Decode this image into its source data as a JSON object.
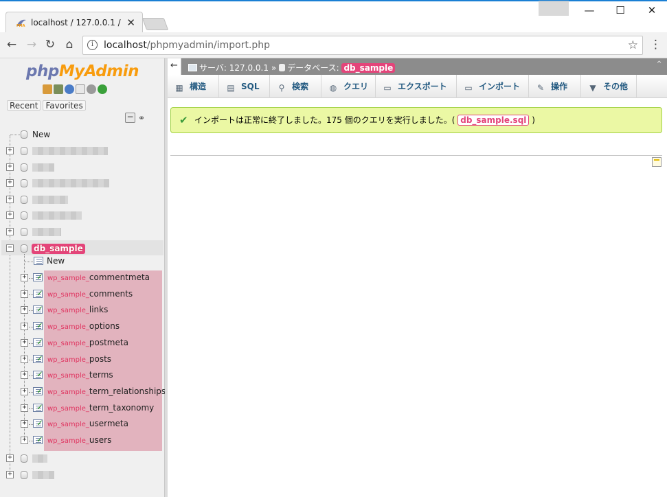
{
  "browser": {
    "tab_title": "localhost / 127.0.0.1 / ",
    "tab_favicon": "pma-favicon",
    "url_host": "localhost",
    "url_path": "/phpmyadmin/import.php",
    "accent_color": "#1a7fd4"
  },
  "nav": {
    "logo_php": "php",
    "logo_my": "My",
    "logo_admin": "Admin",
    "recent_label": "Recent",
    "favorites_label": "Favorites",
    "new_label": "New",
    "db_new_label": "New",
    "selected_db": "db_sample",
    "tables": [
      {
        "prefix": "wp_sample_",
        "name": "commentmeta"
      },
      {
        "prefix": "wp_sample_",
        "name": "comments"
      },
      {
        "prefix": "wp_sample_",
        "name": "links"
      },
      {
        "prefix": "wp_sample_",
        "name": "options"
      },
      {
        "prefix": "wp_sample_",
        "name": "postmeta"
      },
      {
        "prefix": "wp_sample_",
        "name": "posts"
      },
      {
        "prefix": "wp_sample_",
        "name": "terms"
      },
      {
        "prefix": "wp_sample_",
        "name": "term_relationships"
      },
      {
        "prefix": "wp_sample_",
        "name": "term_taxonomy"
      },
      {
        "prefix": "wp_sample_",
        "name": "usermeta"
      },
      {
        "prefix": "wp_sample_",
        "name": "users"
      }
    ],
    "highlight_color": "#e4447a"
  },
  "breadcrumb": {
    "server_label": "サーバ: 127.0.0.1",
    "separator": "»",
    "database_label": "データベース:",
    "database_name": "db_sample"
  },
  "menu": {
    "items": [
      {
        "label": "構造",
        "icon": "structure-icon"
      },
      {
        "label": "SQL",
        "icon": "sql-icon"
      },
      {
        "label": "検索",
        "icon": "search-icon"
      },
      {
        "label": "クエリ",
        "icon": "query-icon"
      },
      {
        "label": "エクスポート",
        "icon": "export-icon"
      },
      {
        "label": "インポート",
        "icon": "import-icon"
      },
      {
        "label": "操作",
        "icon": "operations-icon"
      },
      {
        "label": "その他",
        "icon": "more-icon"
      }
    ]
  },
  "message": {
    "text": "インポートは正常に終了しました。175 個のクエリを実行しました。(",
    "file": "db_sample.sql",
    "close_paren": ")",
    "status_color": "#ebf8a4"
  }
}
